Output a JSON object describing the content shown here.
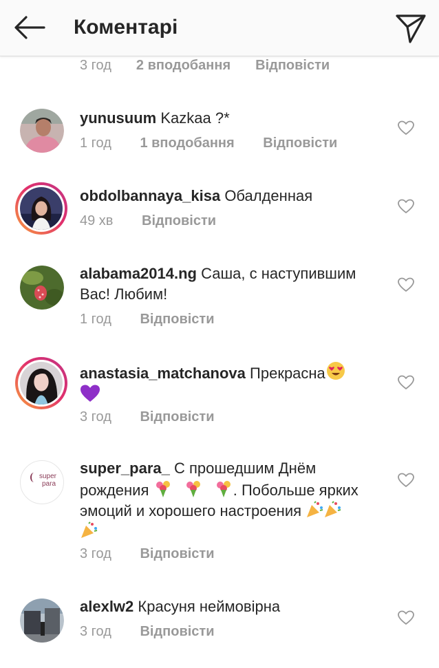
{
  "header": {
    "title": "Коментарі"
  },
  "top_meta": {
    "time": "3 год",
    "likes": "2 вподобання",
    "reply": "Відповісти"
  },
  "comments": [
    {
      "username": "yunusuum",
      "text": "Kazkaa ?*",
      "time": "1 год",
      "likes": "1 вподобання",
      "reply": "Відповісти"
    },
    {
      "username": "obdolbannaya_kisa",
      "text": "Обалденная",
      "time": "49 хв",
      "reply": "Відповісти"
    },
    {
      "username": "alabama2014.ng",
      "text": "Саша, с наступившим Вас! Любим!",
      "time": "1 год",
      "reply": "Відповісти"
    },
    {
      "username": "anastasia_matchanova",
      "text": "Прекрасна",
      "time": "3 год",
      "reply": "Відповісти"
    },
    {
      "username": "super_para_",
      "text_1": "С прошедшим Днём рождения",
      "text_2": ". Побольше ярких эмоций и хорошего настроения",
      "time": "3 год",
      "reply": "Відповісти",
      "avatar_line1": "super",
      "avatar_line2": "para"
    },
    {
      "username": "alexlw2",
      "text": "Красуня неймовірна",
      "time": "3 год",
      "reply": "Відповісти"
    }
  ],
  "colors": {
    "text": "#262626",
    "meta": "#999999",
    "header_bg": "#fafafa",
    "story_ring": "#e1306c"
  },
  "icons": [
    "back-arrow-icon",
    "send-icon",
    "heart-icon",
    "heart-eyes-emoji",
    "purple-heart-emoji",
    "bouquet-emoji",
    "party-popper-emoji"
  ]
}
